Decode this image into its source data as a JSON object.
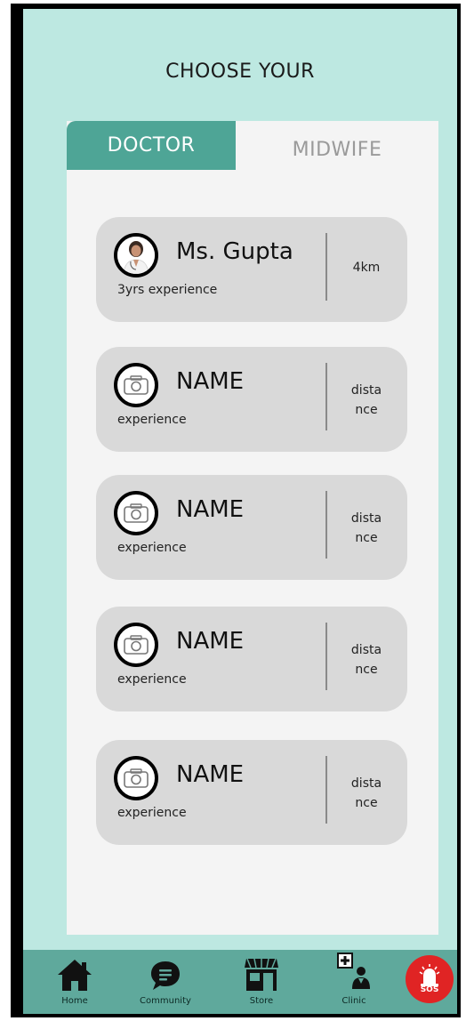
{
  "header": {
    "title": "CHOOSE YOUR"
  },
  "tabs": [
    {
      "label": "DOCTOR",
      "active": true
    },
    {
      "label": "MIDWIFE",
      "active": false
    }
  ],
  "cards": [
    {
      "name": "Ms. Gupta",
      "experience": "3yrs experience",
      "distance": "4km",
      "avatar": "doctor-photo"
    },
    {
      "name": "NAME",
      "experience": "experience",
      "distance": "dista\nnce",
      "avatar": "camera-icon"
    },
    {
      "name": "NAME",
      "experience": "experience",
      "distance": "dista\nnce",
      "avatar": "camera-icon"
    },
    {
      "name": "NAME",
      "experience": "experience",
      "distance": "dista\nnce",
      "avatar": "camera-icon"
    },
    {
      "name": "NAME",
      "experience": "experience",
      "distance": "dista\nnce",
      "avatar": "camera-icon"
    }
  ],
  "nav": [
    {
      "label": "Home",
      "icon": "home-icon"
    },
    {
      "label": "Community",
      "icon": "chat-icon"
    },
    {
      "label": "Store",
      "icon": "store-icon"
    },
    {
      "label": "Clinic",
      "icon": "clinic-icon"
    },
    {
      "label": "SOS",
      "icon": "alarm-icon"
    }
  ],
  "colors": {
    "background": "#bde8e1",
    "accent": "#4ea596",
    "navbar": "#5fa99c",
    "sos": "#e02424",
    "card": "#d9d9d9"
  }
}
